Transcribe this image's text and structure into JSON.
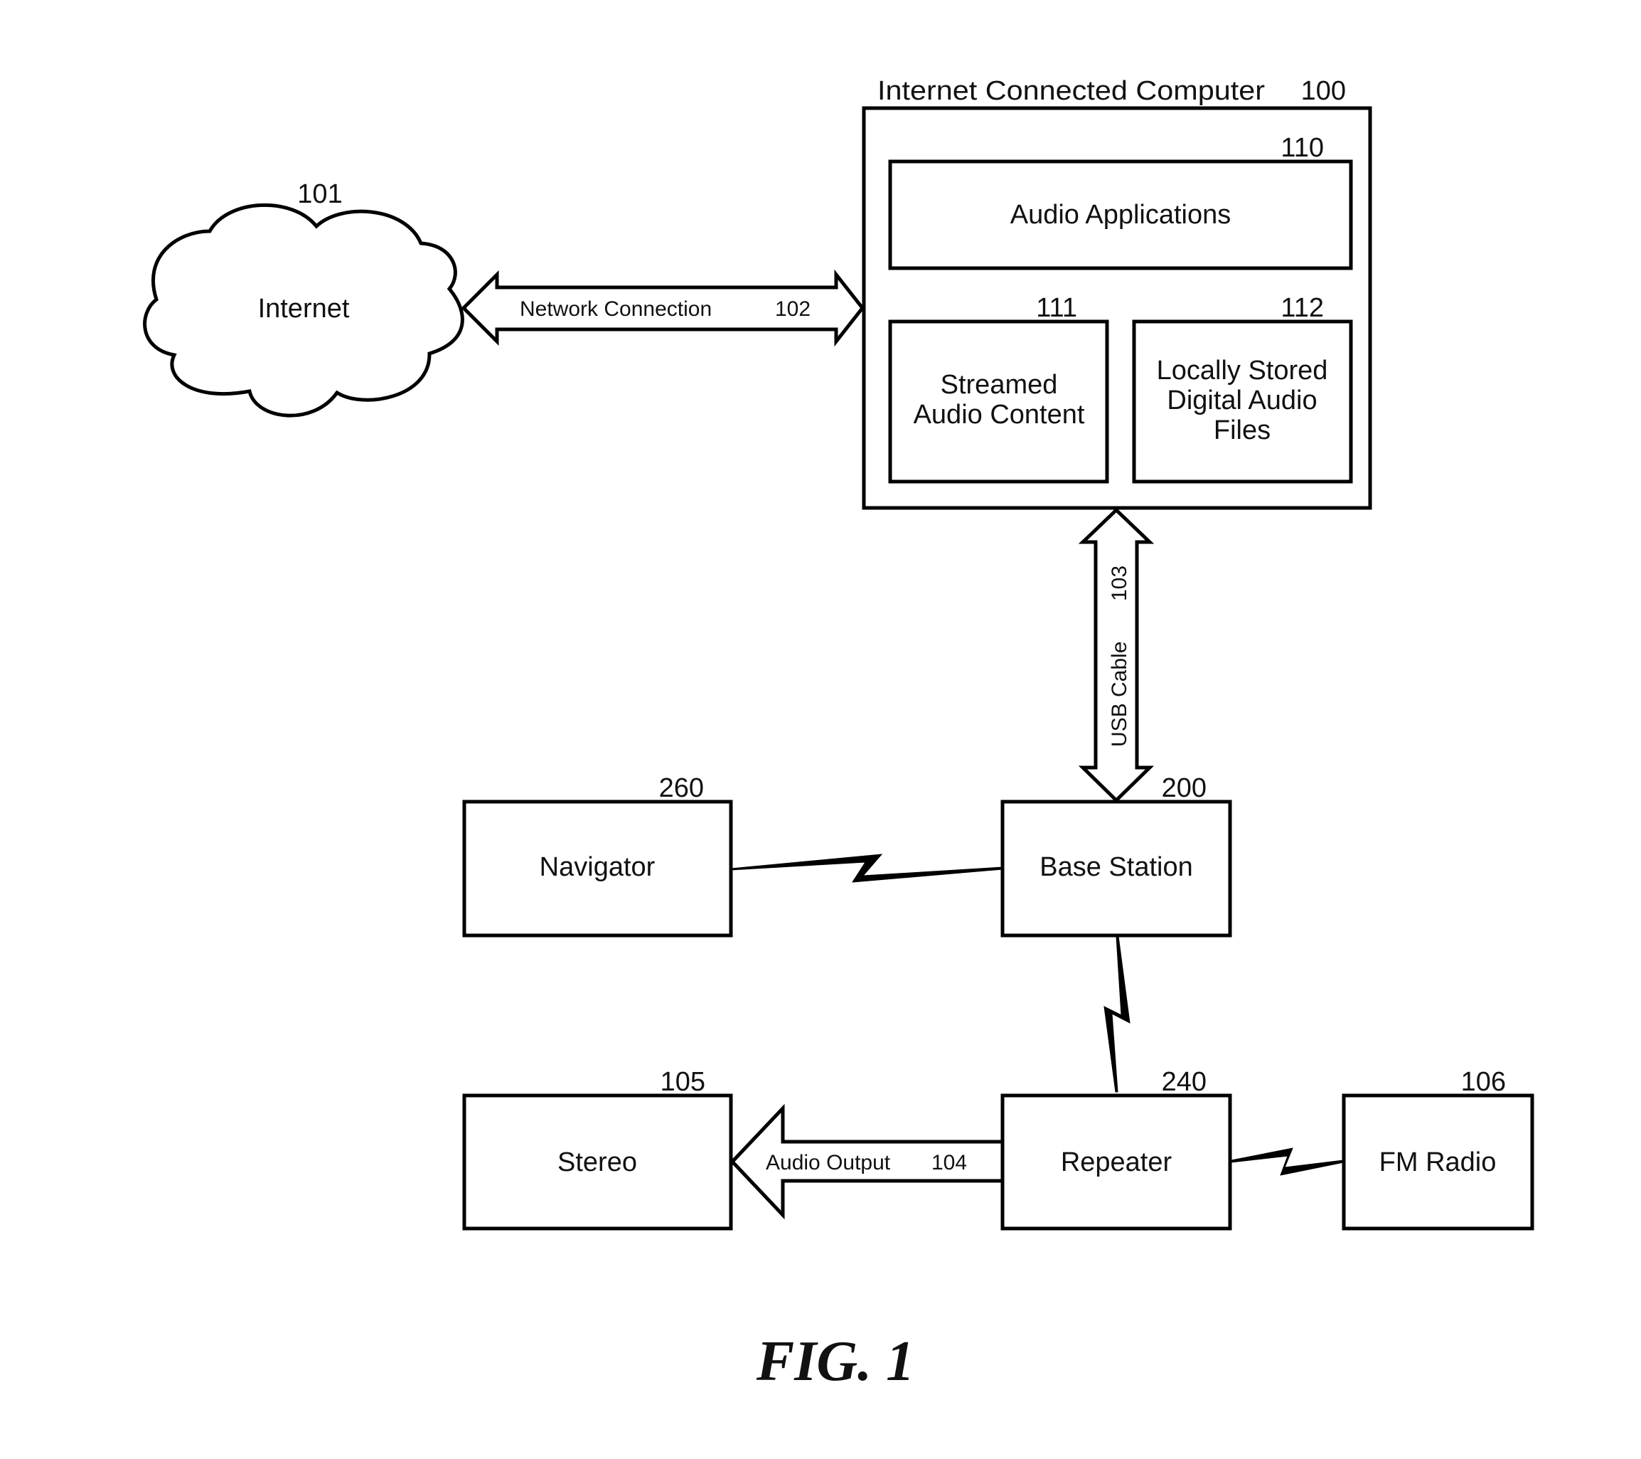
{
  "figure": {
    "caption": "FIG. 1",
    "colors": {
      "stroke": "#000000",
      "background": "#ffffff",
      "text": "#111111"
    }
  },
  "nodes": {
    "internet": {
      "label": "Internet",
      "ref": "101",
      "shape": "cloud"
    },
    "computer": {
      "label": "Internet Connected Computer",
      "ref": "100"
    },
    "audio_applications": {
      "label": "Audio Applications",
      "ref": "110"
    },
    "streamed_audio": {
      "label_lines": [
        "Streamed",
        "Audio Content"
      ],
      "ref": "111"
    },
    "local_files": {
      "label_lines": [
        "Locally Stored",
        "Digital Audio",
        "Files"
      ],
      "ref": "112"
    },
    "navigator": {
      "label": "Navigator",
      "ref": "260"
    },
    "base_station": {
      "label": "Base Station",
      "ref": "200"
    },
    "stereo": {
      "label": "Stereo",
      "ref": "105"
    },
    "repeater": {
      "label": "Repeater",
      "ref": "240"
    },
    "fm_radio": {
      "label": "FM Radio",
      "ref": "106"
    }
  },
  "connections": {
    "network": {
      "label": "Network Connection",
      "ref": "102",
      "type": "double-arrow",
      "from": "internet",
      "to": "computer"
    },
    "usb": {
      "label": "USB Cable",
      "ref": "103",
      "type": "double-arrow",
      "from": "computer",
      "to": "base_station"
    },
    "audio_output": {
      "label": "Audio Output",
      "ref": "104",
      "type": "arrow",
      "from": "repeater",
      "to": "stereo"
    },
    "wireless_nav": {
      "type": "wireless-bolt",
      "from": "base_station",
      "to": "navigator"
    },
    "wireless_repeater": {
      "type": "wireless-bolt",
      "from": "base_station",
      "to": "repeater"
    },
    "wireless_fm": {
      "type": "wireless-bolt",
      "from": "fm_radio",
      "to": "repeater"
    }
  }
}
